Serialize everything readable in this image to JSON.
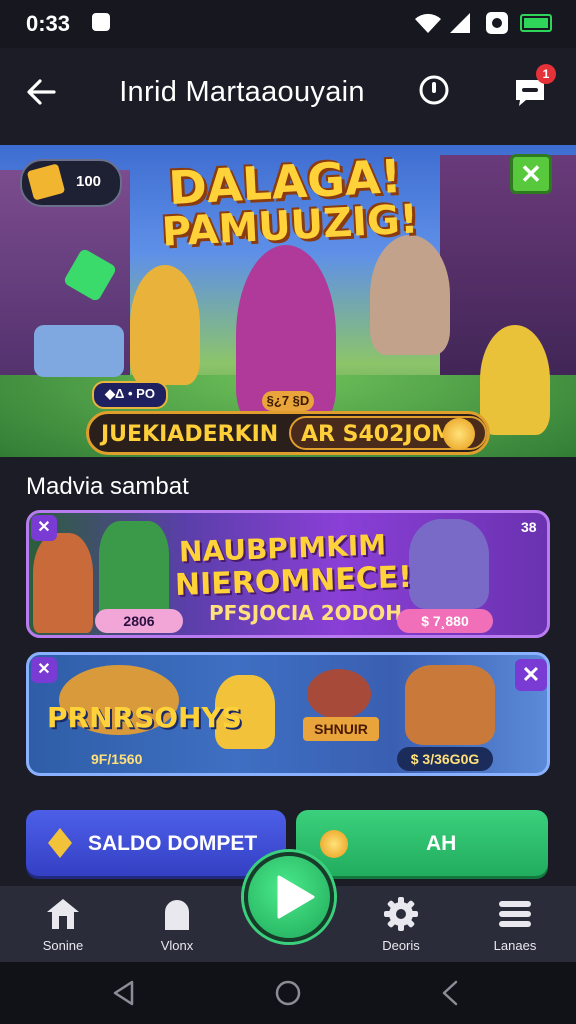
{
  "status_bar": {
    "time": "0:33"
  },
  "header": {
    "title": "Inrid Martaaouyain",
    "chat_badge": "1"
  },
  "hero": {
    "coin_count": "100",
    "title_line1": "DALAGA!",
    "title_line2": "PAMUUZIG!",
    "small_pill": "◆Δ • PO",
    "mid_pill": "§¿7 §D",
    "strip_left": "JUEKIADERKIN",
    "strip_right": "AR S402JOM",
    "close_icon_label": "✕"
  },
  "section": {
    "title": "Madvia sambat"
  },
  "promo1": {
    "title_line1": "NAUBPIMKIM",
    "title_line2": "NIEROMNECE!",
    "subtitle": "PFSJOCIA 2ODOH",
    "left_pill": "2806",
    "right_pill": "$ 7¸880",
    "corner_number": "38",
    "close_label": "✕"
  },
  "promo2": {
    "title": "PRNRSOHYS",
    "subtitle": "9F/1560",
    "sign": "SHNUIR",
    "right_pill": "$ 3/36G0G",
    "close_label": "✕"
  },
  "actions": {
    "saldo_label": "SALDO DOMPET",
    "ah_label": "AH"
  },
  "nav": {
    "items": [
      {
        "label": "Sonine",
        "icon": "home-icon"
      },
      {
        "label": "Vlonx",
        "icon": "person-icon"
      },
      {
        "label": "Deoris",
        "icon": "gear-icon"
      },
      {
        "label": "Lanaes",
        "icon": "menu-icon"
      }
    ],
    "center_icon": "play-icon"
  },
  "colors": {
    "accent_green": "#3ad07c",
    "accent_blue": "#4d5fe8",
    "badge_red": "#e53238"
  }
}
